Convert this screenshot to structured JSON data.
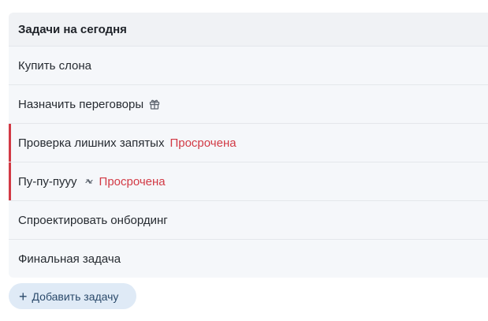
{
  "panel": {
    "title": "Задачи на сегодня"
  },
  "tasks": [
    {
      "title": "Купить слона",
      "overdue_label": "",
      "icon": ""
    },
    {
      "title": "Назначить переговоры",
      "overdue_label": "",
      "icon": "gift-icon"
    },
    {
      "title": "Проверка лишних запятых",
      "overdue_label": "Просрочена",
      "icon": ""
    },
    {
      "title": "Пу-пу-пууу",
      "overdue_label": "Просрочена",
      "icon": "repeat-icon"
    },
    {
      "title": "Спроектировать онбординг",
      "overdue_label": "",
      "icon": ""
    },
    {
      "title": "Финальная задача",
      "overdue_label": "",
      "icon": ""
    }
  ],
  "add_button": {
    "plus": "+",
    "label": "Добавить задачу"
  },
  "colors": {
    "overdue": "#d23a45",
    "panel_bg": "#f5f7fa",
    "button_bg": "#dfeaf6"
  }
}
